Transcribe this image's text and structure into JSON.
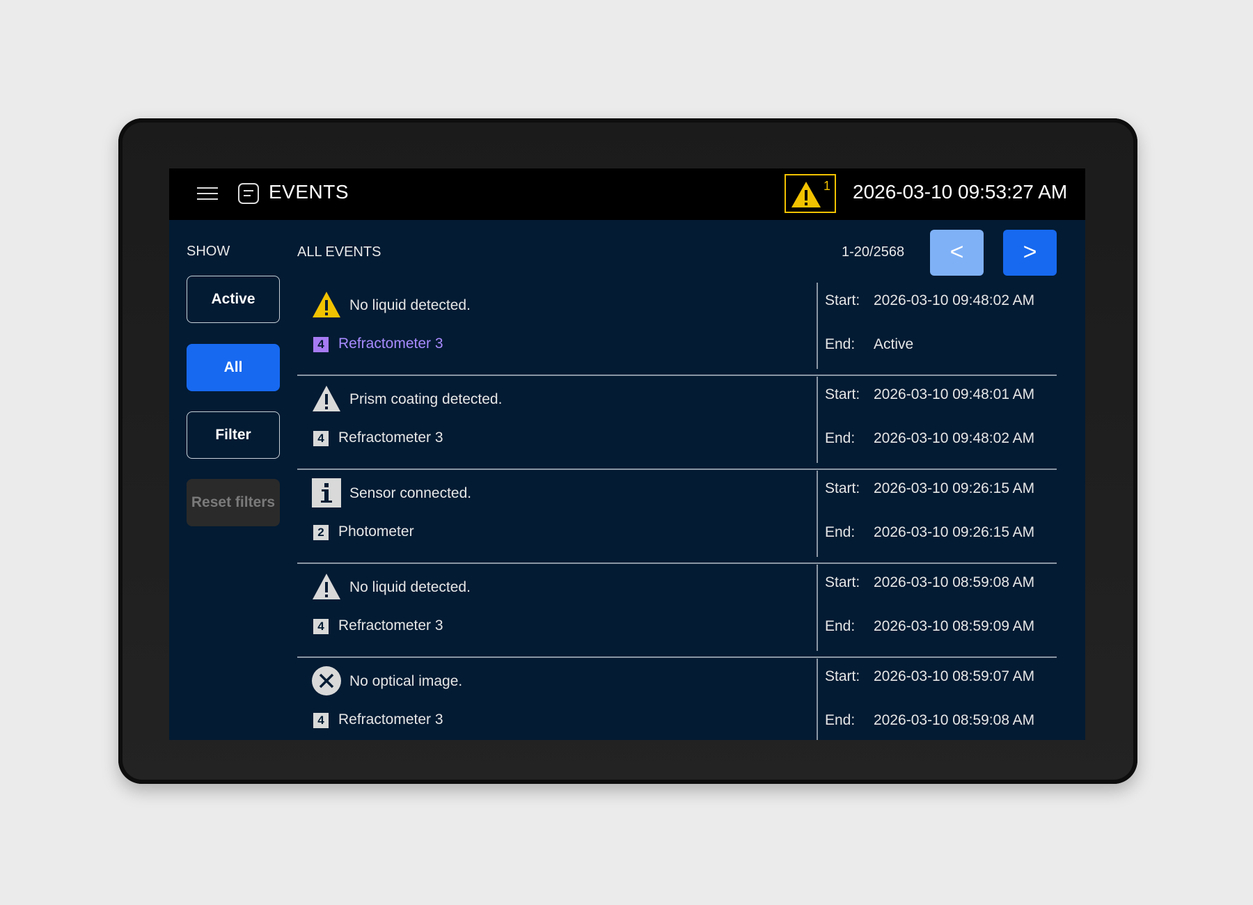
{
  "header": {
    "title": "EVENTS",
    "alert_count": "1",
    "datetime": "2026-03-10 09:53:27 AM"
  },
  "sidebar": {
    "show_label": "SHOW",
    "buttons": {
      "active": "Active",
      "all": "All",
      "filter": "Filter",
      "reset": "Reset filters"
    }
  },
  "main": {
    "title": "ALL EVENTS",
    "pagination": "1-20/2568",
    "prev_label": "<",
    "next_label": ">"
  },
  "events": [
    {
      "icon": "warning-yellow-icon",
      "message": "No liquid detected.",
      "unit_number": "4",
      "unit": "Refractometer 3",
      "start_label": "Start:",
      "start": "2026-03-10 09:48:02 AM",
      "end_label": "End:",
      "end": "Active"
    },
    {
      "icon": "warning-gray-icon",
      "message": "Prism coating detected.",
      "unit_number": "4",
      "unit": "Refractometer 3",
      "start_label": "Start:",
      "start": "2026-03-10 09:48:01 AM",
      "end_label": "End:",
      "end": "2026-03-10 09:48:02 AM"
    },
    {
      "icon": "info-icon",
      "message": "Sensor connected.",
      "unit_number": "2",
      "unit": "Photometer",
      "start_label": "Start:",
      "start": "2026-03-10 09:26:15 AM",
      "end_label": "End:",
      "end": "2026-03-10 09:26:15 AM"
    },
    {
      "icon": "warning-gray-icon",
      "message": "No liquid detected.",
      "unit_number": "4",
      "unit": "Refractometer 3",
      "start_label": "Start:",
      "start": "2026-03-10 08:59:08 AM",
      "end_label": "End:",
      "end": "2026-03-10 08:59:09 AM"
    },
    {
      "icon": "error-circle-icon",
      "message": "No optical image.",
      "unit_number": "4",
      "unit": "Refractometer 3",
      "start_label": "Start:",
      "start": "2026-03-10 08:59:07 AM",
      "end_label": "End:",
      "end": "2026-03-10 08:59:08 AM"
    }
  ],
  "colors": {
    "screen_bg": "#031b33",
    "header_bg": "#000000",
    "primary": "#1769f0",
    "primary_light": "#7fb1f7",
    "warning": "#f2c200",
    "active_unit": "#a88bff"
  }
}
